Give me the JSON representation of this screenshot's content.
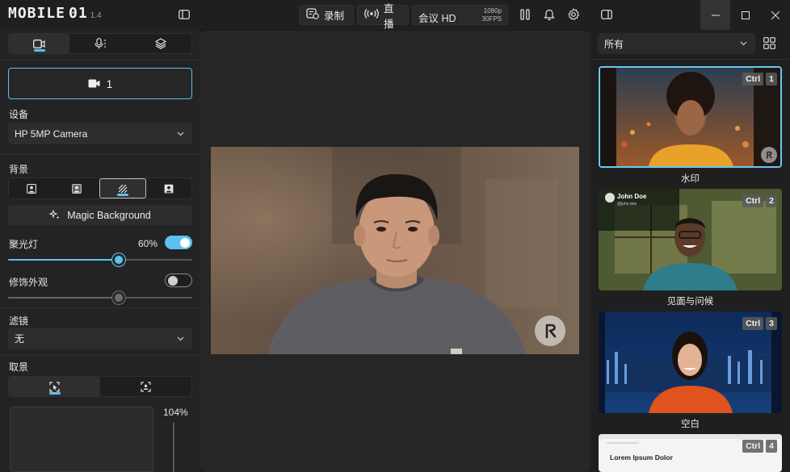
{
  "app": {
    "logo_text": "MOBILE",
    "logo_sub": "01",
    "version": "1.4"
  },
  "toolbar": {
    "record_label": "录制",
    "live_label": "直播",
    "quality_label": "会议 HD",
    "quality_res": "1080p",
    "quality_fps": "30FPS"
  },
  "left": {
    "source_button": "1",
    "device_label": "设备",
    "device_value": "HP 5MP Camera",
    "background_label": "背景",
    "magic_bg_label": "Magic Background",
    "spotlight_label": "聚光灯",
    "spotlight_value": "60%",
    "spotlight_level": 0.6,
    "touchup_label": "修饰外观",
    "touchup_level": 0.6,
    "filter_label": "滤镜",
    "filter_value": "无",
    "framing_label": "取景",
    "zoom_value": "104%"
  },
  "right": {
    "filter_value": "所有",
    "cards": [
      {
        "label": "水印",
        "ctrl": "Ctrl",
        "num": "1"
      },
      {
        "label": "见面与问候",
        "ctrl": "Ctrl",
        "num": "2"
      },
      {
        "label": "空白",
        "ctrl": "Ctrl",
        "num": "3"
      },
      {
        "label": "",
        "ctrl": "Ctrl",
        "num": "4"
      }
    ],
    "card2_name": "John Doe",
    "card2_handle": "@john.doe",
    "card4_title": "Lorem Ipsum Dolor"
  },
  "colors": {
    "accent": "#5cc1f0",
    "panel": "#232323",
    "stage": "#262626"
  }
}
